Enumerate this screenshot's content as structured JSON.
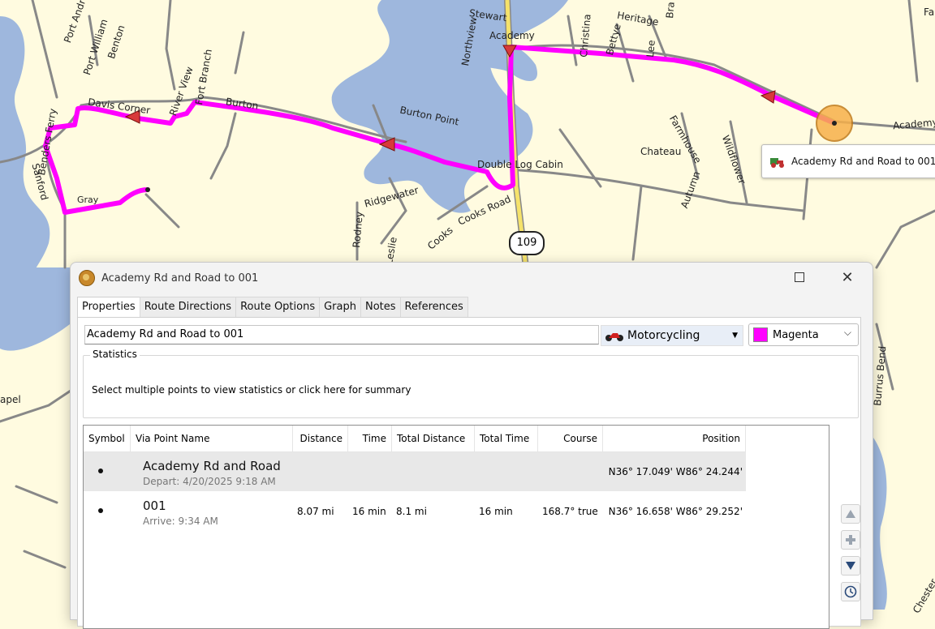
{
  "map": {
    "labels": [
      {
        "id": "port-andreas",
        "text": "Port Andreas"
      },
      {
        "id": "port-william",
        "text": "Port William"
      },
      {
        "id": "benton",
        "text": "Benton"
      },
      {
        "id": "davis-corner",
        "text": "Davis Corner"
      },
      {
        "id": "river-view",
        "text": "River View"
      },
      {
        "id": "fort-branch",
        "text": "Fort Branch"
      },
      {
        "id": "burton",
        "text": "Burton"
      },
      {
        "id": "burton-point",
        "text": "Burton Point"
      },
      {
        "id": "stewart",
        "text": "Stewart"
      },
      {
        "id": "northview",
        "text": "Northview"
      },
      {
        "id": "academy",
        "text": "Academy"
      },
      {
        "id": "christina",
        "text": "Christina"
      },
      {
        "id": "bettye",
        "text": "Bettye"
      },
      {
        "id": "heritage",
        "text": "Heritage"
      },
      {
        "id": "lee",
        "text": "Lee"
      },
      {
        "id": "bra",
        "text": "Bra"
      },
      {
        "id": "academy-east",
        "text": "Academy"
      },
      {
        "id": "farmhouse",
        "text": "Farmhouse"
      },
      {
        "id": "chateau",
        "text": "Chateau"
      },
      {
        "id": "wildflower",
        "text": "Wildflower"
      },
      {
        "id": "autumn",
        "text": "Autumn"
      },
      {
        "id": "double-log-cabin",
        "text": "Double Log Cabin"
      },
      {
        "id": "ridgewater",
        "text": "Ridgewater"
      },
      {
        "id": "rodney",
        "text": "Rodney"
      },
      {
        "id": "leslie",
        "text": "Leslie"
      },
      {
        "id": "cooks",
        "text": "Cooks"
      },
      {
        "id": "cooks-road",
        "text": "Cooks Road"
      },
      {
        "id": "benders-ferry",
        "text": "Benders Ferry"
      },
      {
        "id": "sanford",
        "text": "Sanford"
      },
      {
        "id": "gray",
        "text": "Gray"
      },
      {
        "id": "chapel",
        "text": "apel"
      },
      {
        "id": "burrus-bend",
        "text": "Burrus Bend"
      },
      {
        "id": "chester",
        "text": "Chester"
      },
      {
        "id": "fa",
        "text": "Fa"
      }
    ],
    "highway_shield": "109",
    "tooltip": "Academy Rd and Road to 001",
    "route_color": "#ff00ff"
  },
  "window": {
    "title": "Academy Rd and Road to 001",
    "tabs": [
      "Properties",
      "Route Directions",
      "Route Options",
      "Graph",
      "Notes",
      "References"
    ],
    "route_name": "Academy Rd and Road to 001",
    "mode": "Motorcycling",
    "color": "Magenta",
    "statistics_label": "Statistics",
    "statistics_msg": "Select multiple points to view statistics or click here for summary",
    "columns": [
      "Symbol",
      "Via Point Name",
      "Distance",
      "Time",
      "Total Distance",
      "Total Time",
      "Course",
      "Position"
    ],
    "rows": [
      {
        "name": "Academy Rd and Road",
        "sub": "Depart: 4/20/2025 9:18 AM",
        "distance": "",
        "time": "",
        "total_distance": "",
        "total_time": "",
        "course": "",
        "position": "N36° 17.049' W86° 24.244'"
      },
      {
        "name": "001",
        "sub": "Arrive: 9:34 AM",
        "distance": "8.07 mi",
        "time": "16 min",
        "total_distance": "8.1 mi",
        "total_time": "16 min",
        "course": "168.7° true",
        "position": "N36° 16.658' W86° 29.252'"
      }
    ]
  }
}
